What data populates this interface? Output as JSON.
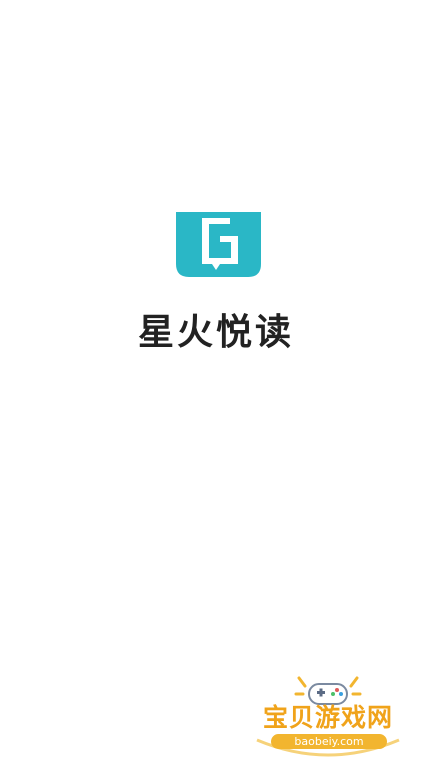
{
  "app": {
    "name": "星火悦读",
    "icon": "book-logo-icon",
    "brand_color": "#2ab7c6"
  },
  "watermark": {
    "title": "宝贝游戏网",
    "domain": "baobeiy.com",
    "icon": "gamepad-icon",
    "color": "#f0a31a"
  }
}
